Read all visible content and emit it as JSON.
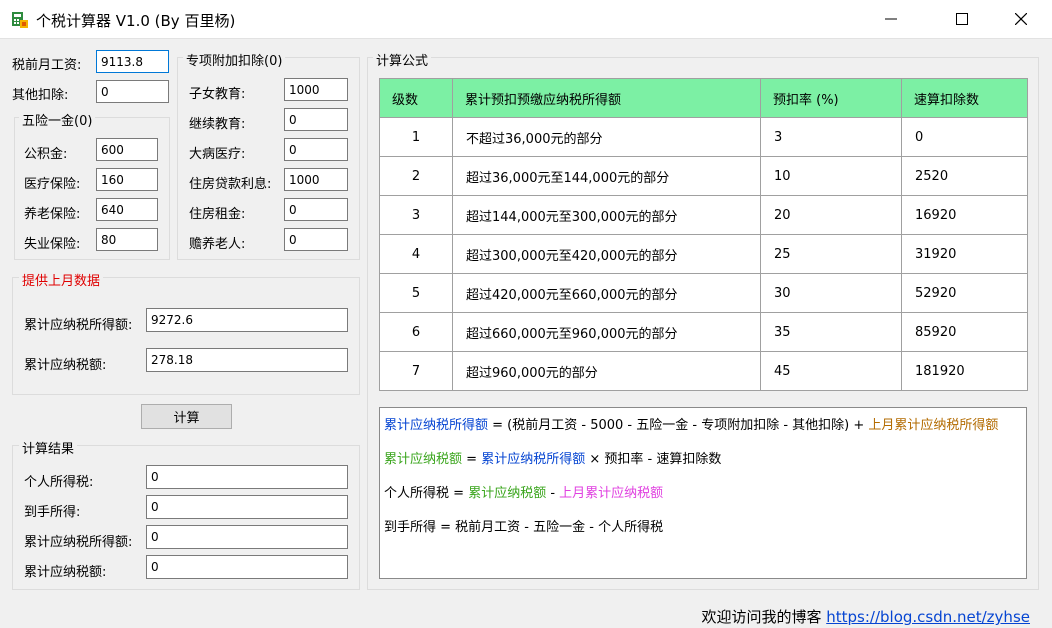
{
  "window": {
    "title": "个税计算器 V1.0 (By 百里杨)",
    "controls": [
      "minimize",
      "maximize",
      "close"
    ]
  },
  "inputs": {
    "salary_label": "税前月工资:",
    "salary_value": "9113.8",
    "other_label": "其他扣除:",
    "other_value": "0"
  },
  "insurance": {
    "legend": "五险一金(0)",
    "items": [
      {
        "label": "公积金:",
        "value": "600"
      },
      {
        "label": "医疗保险:",
        "value": "160"
      },
      {
        "label": "养老保险:",
        "value": "640"
      },
      {
        "label": "失业保险:",
        "value": "80"
      }
    ]
  },
  "special": {
    "legend": "专项附加扣除(0)",
    "items": [
      {
        "label": "子女教育:",
        "value": "1000"
      },
      {
        "label": "继续教育:",
        "value": "0"
      },
      {
        "label": "大病医疗:",
        "value": "0"
      },
      {
        "label": "住房贷款利息:",
        "value": "1000"
      },
      {
        "label": "住房租金:",
        "value": "0"
      },
      {
        "label": "赡养老人:",
        "value": "0"
      }
    ]
  },
  "last_month": {
    "legend": "提供上月数据",
    "legend_color": "#e00000",
    "items": [
      {
        "label": "累计应纳税所得额:",
        "value": "9272.6"
      },
      {
        "label": "累计应纳税额:",
        "value": "278.18"
      }
    ]
  },
  "calc_button": "计算",
  "results": {
    "legend": "计算结果",
    "items": [
      {
        "label": "个人所得税:",
        "value": "0"
      },
      {
        "label": "到手所得:",
        "value": "0"
      },
      {
        "label": "累计应纳税所得额:",
        "value": "0"
      },
      {
        "label": "累计应纳税额:",
        "value": "0"
      }
    ]
  },
  "formula": {
    "legend": "计算公式",
    "header_color": "#7cf0a4",
    "columns": [
      "级数",
      "累计预扣预缴应纳税所得额",
      "预扣率 (%)",
      "速算扣除数"
    ],
    "rows": [
      [
        "1",
        "不超过36,000元的部分",
        "3",
        "0"
      ],
      [
        "2",
        "超过36,000元至144,000元的部分",
        "10",
        "2520"
      ],
      [
        "3",
        "超过144,000元至300,000元的部分",
        "20",
        "16920"
      ],
      [
        "4",
        "超过300,000元至420,000元的部分",
        "25",
        "31920"
      ],
      [
        "5",
        "超过420,000元至660,000元的部分",
        "30",
        "52920"
      ],
      [
        "6",
        "超过660,000元至960,000元的部分",
        "35",
        "85920"
      ],
      [
        "7",
        "超过960,000元的部分",
        "45",
        "181920"
      ]
    ],
    "lines": {
      "l1": {
        "a": "累计应纳税所得额",
        "b": " = (税前月工资 - 5000 - 五险一金 - 专项附加扣除 - 其他扣除) + ",
        "c": "上月累计应纳税所得额"
      },
      "l2": {
        "a": "累计应纳税额",
        "b": " = ",
        "c": "累计应纳税所得额",
        "d": " × 预扣率 - 速算扣除数"
      },
      "l3": {
        "a": "个人所得税",
        "b": " = ",
        "c": "累计应纳税额",
        "d": " - ",
        "e": "上月累计应纳税额"
      },
      "l4": "到手所得 = 税前月工资 - 五险一金 - 个人所得税"
    }
  },
  "footer": {
    "text": "欢迎访问我的博客",
    "link": "https://blog.csdn.net/zyhse"
  }
}
